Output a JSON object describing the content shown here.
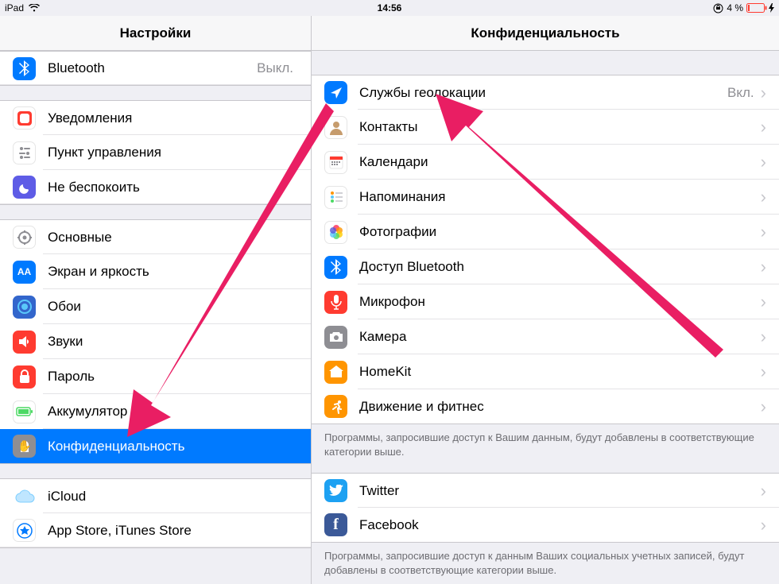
{
  "status": {
    "device": "iPad",
    "time": "14:56",
    "battery_pct": "4 %"
  },
  "sidebar": {
    "title": "Настройки",
    "groups": [
      [
        {
          "id": "bluetooth",
          "label": "Bluetooth",
          "value": "Выкл.",
          "icon": "bluetooth-icon"
        }
      ],
      [
        {
          "id": "notifications",
          "label": "Уведомления",
          "icon": "notifications-icon"
        },
        {
          "id": "control-center",
          "label": "Пункт управления",
          "icon": "control-center-icon"
        },
        {
          "id": "dnd",
          "label": "Не беспокоить",
          "icon": "dnd-icon"
        }
      ],
      [
        {
          "id": "general",
          "label": "Основные",
          "icon": "general-icon"
        },
        {
          "id": "display",
          "label": "Экран и яркость",
          "icon": "display-icon"
        },
        {
          "id": "wallpaper",
          "label": "Обои",
          "icon": "wallpaper-icon"
        },
        {
          "id": "sounds",
          "label": "Звуки",
          "icon": "sounds-icon"
        },
        {
          "id": "passcode",
          "label": "Пароль",
          "icon": "passcode-icon"
        },
        {
          "id": "battery",
          "label": "Аккумулятор",
          "icon": "battery-icon"
        },
        {
          "id": "privacy",
          "label": "Конфиденциальность",
          "icon": "privacy-icon",
          "selected": true
        }
      ],
      [
        {
          "id": "icloud",
          "label": "iCloud",
          "icon": "icloud-icon"
        },
        {
          "id": "appstore",
          "label": "App Store, iTunes Store",
          "icon": "appstore-icon"
        }
      ]
    ]
  },
  "detail": {
    "title": "Конфиденциальность",
    "groups": [
      {
        "items": [
          {
            "id": "location",
            "label": "Службы геолокации",
            "value": "Вкл.",
            "icon": "location-icon"
          },
          {
            "id": "contacts",
            "label": "Контакты",
            "icon": "contacts-icon"
          },
          {
            "id": "calendars",
            "label": "Календари",
            "icon": "calendar-icon"
          },
          {
            "id": "reminders",
            "label": "Напоминания",
            "icon": "reminders-icon"
          },
          {
            "id": "photos",
            "label": "Фотографии",
            "icon": "photos-icon"
          },
          {
            "id": "bt-sharing",
            "label": "Доступ Bluetooth",
            "icon": "bluetooth-share-icon"
          },
          {
            "id": "microphone",
            "label": "Микрофон",
            "icon": "microphone-icon"
          },
          {
            "id": "camera",
            "label": "Камера",
            "icon": "camera-icon"
          },
          {
            "id": "homekit",
            "label": "HomeKit",
            "icon": "homekit-icon"
          },
          {
            "id": "motion",
            "label": "Движение и фитнес",
            "icon": "motion-icon"
          }
        ],
        "footer": "Программы, запросившие доступ к Вашим данным, будут добавлены в соответствующие категории выше."
      },
      {
        "items": [
          {
            "id": "twitter",
            "label": "Twitter",
            "icon": "twitter-icon"
          },
          {
            "id": "facebook",
            "label": "Facebook",
            "icon": "facebook-icon"
          }
        ],
        "footer": "Программы, запросившие доступ к данным Ваших социальных учетных записей, будут добавлены в соответствующие категории выше."
      }
    ]
  }
}
